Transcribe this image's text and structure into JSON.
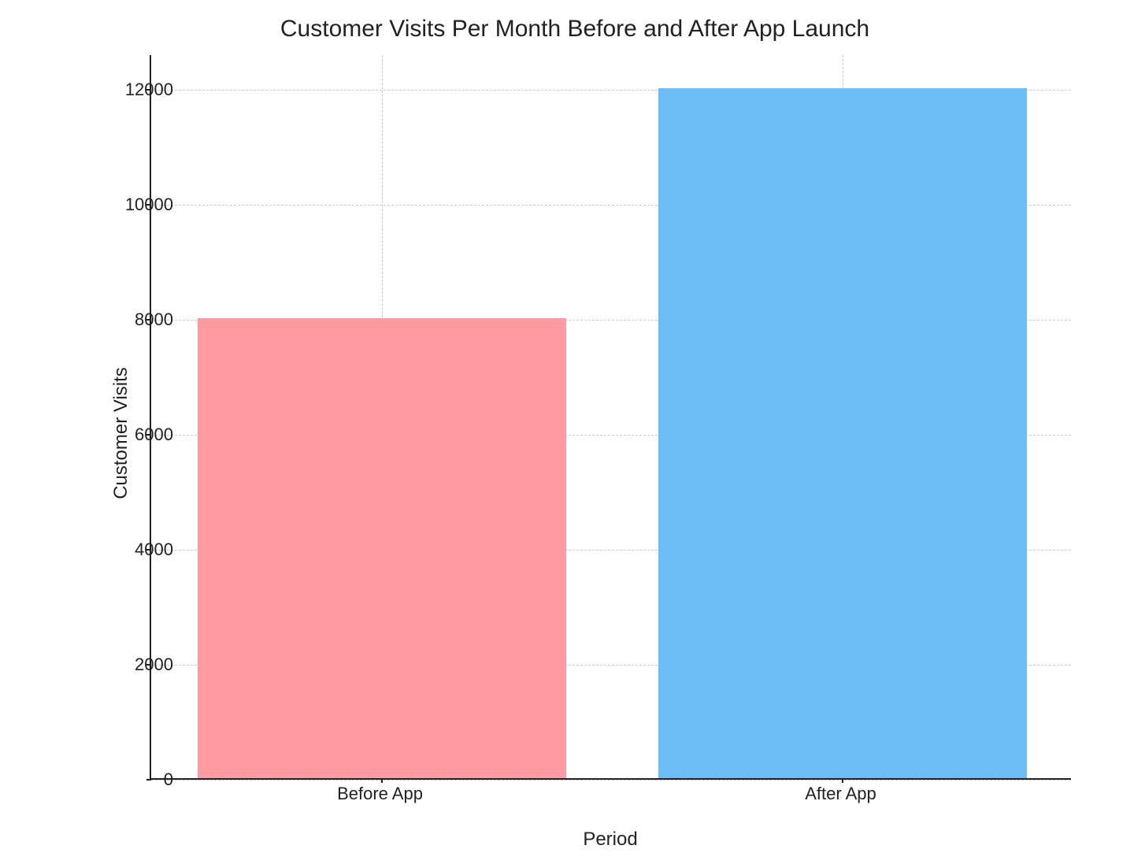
{
  "chart_data": {
    "type": "bar",
    "title": "Customer Visits Per Month Before and After App Launch",
    "xlabel": "Period",
    "ylabel": "Customer Visits",
    "categories": [
      "Before App",
      "After App"
    ],
    "values": [
      8000,
      12000
    ],
    "colors": [
      "#ff9aa2",
      "#6cbdf5"
    ],
    "yticks": [
      0,
      2000,
      4000,
      6000,
      8000,
      10000,
      12000
    ],
    "ylim": [
      0,
      12600
    ]
  }
}
